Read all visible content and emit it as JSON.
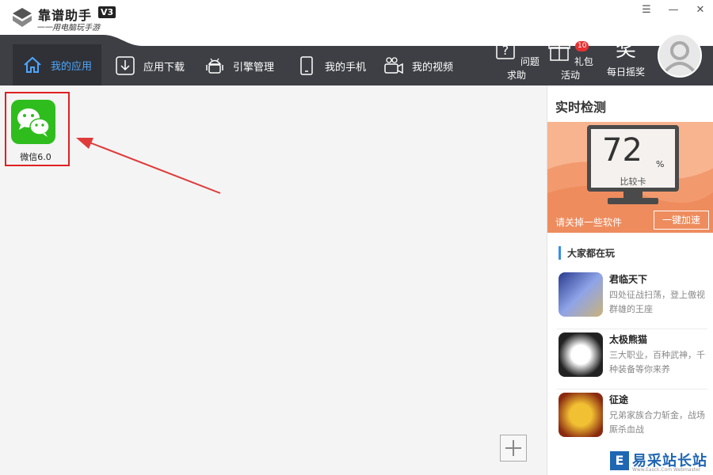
{
  "app": {
    "title": "靠谱助手",
    "version": "V3",
    "subtitle": "一一用电脑玩手游"
  },
  "window_controls": {
    "menu_icon": "menu-icon",
    "minimize_icon": "minimize-icon",
    "close_icon": "close-icon"
  },
  "nav": {
    "tabs": [
      {
        "label": "我的应用",
        "icon": "home-icon",
        "active": true
      },
      {
        "label": "应用下载",
        "icon": "download-icon",
        "active": false
      },
      {
        "label": "引擎管理",
        "icon": "android-icon",
        "active": false
      },
      {
        "label": "我的手机",
        "icon": "phone-icon",
        "active": false
      },
      {
        "label": "我的视频",
        "icon": "video-camera-icon",
        "active": false
      }
    ],
    "tools": [
      {
        "label": "问题求助",
        "icon": "help-icon"
      },
      {
        "label": "礼包活动",
        "icon": "gift-icon",
        "badge": "10"
      },
      {
        "label": "每日摇奖",
        "icon": "lottery-icon"
      }
    ]
  },
  "main": {
    "apps": [
      {
        "label": "微信6.0",
        "icon": "wechat-icon"
      }
    ],
    "add_icon": "plus-icon"
  },
  "right_panel": {
    "title": "实时检测",
    "monitor": {
      "value": "72",
      "unit": "%",
      "status": "比较卡"
    },
    "hint": "请关掉一些软件",
    "accelerate_label": "一键加速",
    "section_title": "大家都在玩",
    "games": [
      {
        "name": "君临天下",
        "desc": "四处征战扫荡，登上傲视群雄的王座"
      },
      {
        "name": "太极熊猫",
        "desc": "三大职业，百种武神，千种装备等你来养"
      },
      {
        "name": "征途",
        "desc": "兄弟家族合力斩金，战场厮杀血战"
      }
    ]
  },
  "watermark": {
    "text": "易采站长站",
    "sub": "Www.Easck.Com Webmaster",
    "logo_char": "E"
  },
  "colors": {
    "navbar": "#3d3f44",
    "active_tab_text": "#4da6ff",
    "wechat_green": "#2fbd1e",
    "highlight_red": "#e02020",
    "monitor_bg": "#f7b48f"
  }
}
